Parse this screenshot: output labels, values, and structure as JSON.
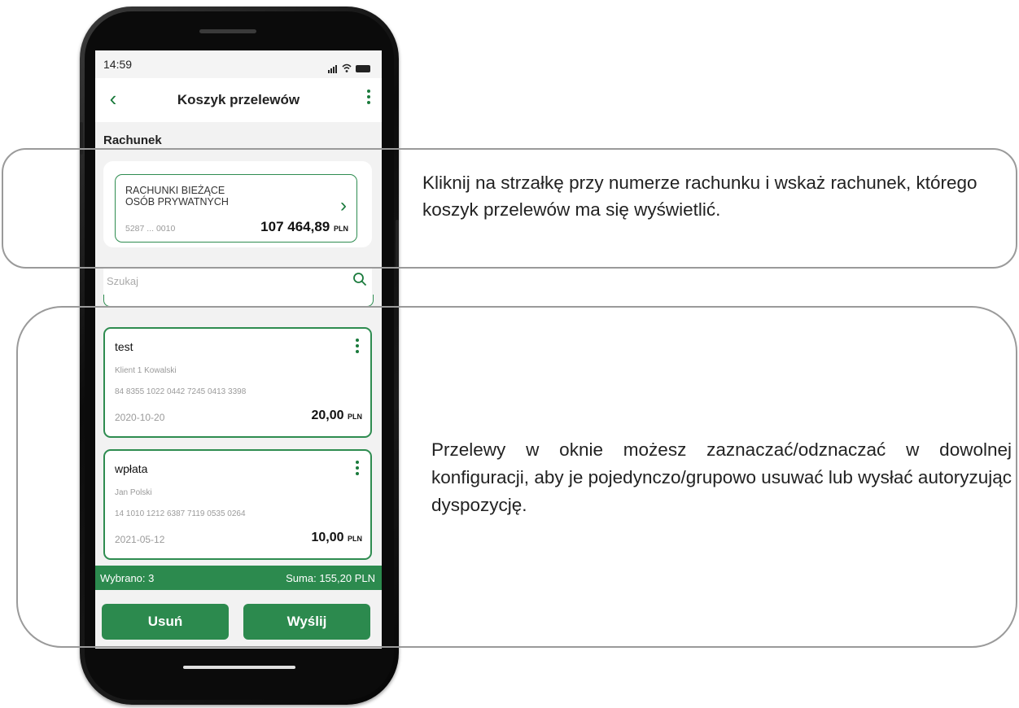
{
  "status_bar": {
    "time": "14:59"
  },
  "header": {
    "title": "Koszyk przelewów"
  },
  "section_label": "Rachunek",
  "account": {
    "name_line1": "RACHUNKI BIEŻĄCE",
    "name_line2": "OSÓB PRYWATNYCH",
    "number": "5287 ... 0010",
    "amount_main": "107 464,89",
    "currency": "PLN"
  },
  "search": {
    "placeholder": "Szukaj"
  },
  "transfers": [
    {
      "name": "test",
      "recipient": "Klient 1 Kowalski",
      "account": "84 8355 1022 0442 7245 0413 3398",
      "date": "2020-10-20",
      "amount": "20,00",
      "currency": "PLN"
    },
    {
      "name": "wpłata",
      "recipient": "Jan Polski",
      "account": "14 1010 1212 6387 7119 0535 0264",
      "date": "2021-05-12",
      "amount": "10,00",
      "currency": "PLN"
    }
  ],
  "summary": {
    "selected": "Wybrano: 3",
    "sum": "Suma: 155,20 PLN"
  },
  "buttons": {
    "delete": "Usuń",
    "send": "Wyślij"
  },
  "descriptions": {
    "account_hint": "Kliknij na strzałkę przy numerze rachunku i wskaż rachunek, którego koszyk przelewów ma się wyświetlić.",
    "transfers_hint": "Przelewy w oknie możesz zaznaczać/odznaczać w dowolnej konfiguracji, aby je pojedynczo/grupowo usuwać lub wysłać autoryzując dyspozycję."
  },
  "colors": {
    "accent": "#2c8a4e",
    "frame": "#9a9a9a"
  }
}
